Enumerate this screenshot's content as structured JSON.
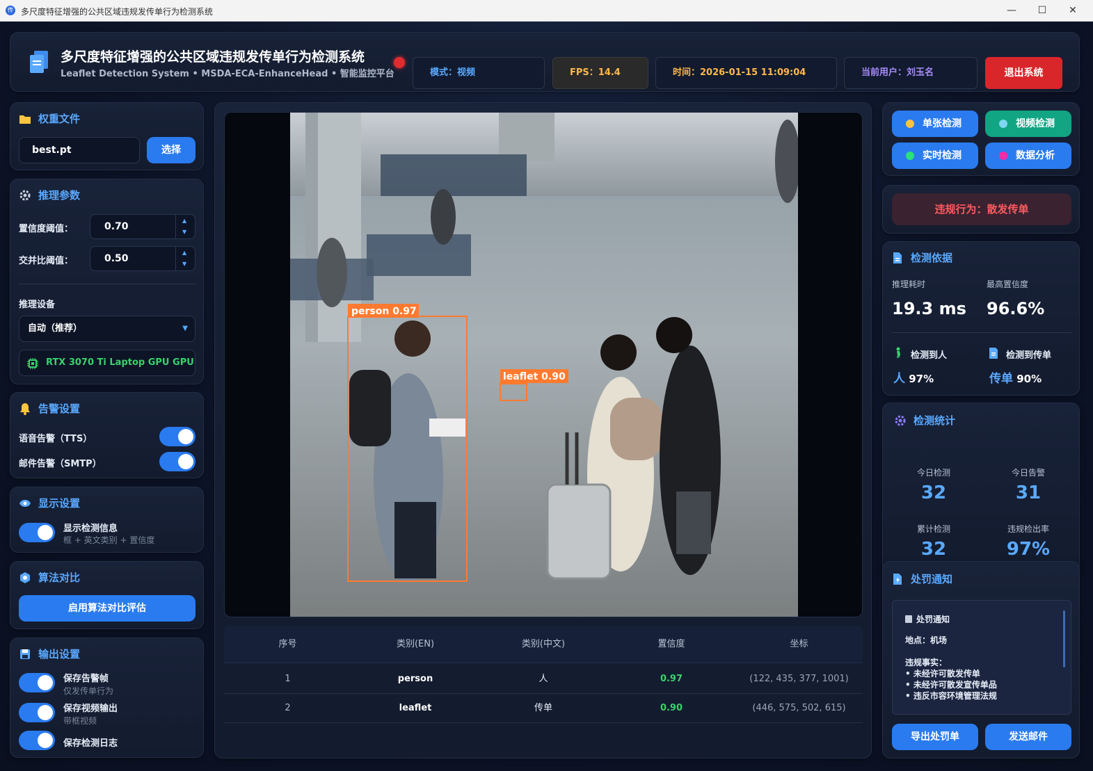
{
  "window": {
    "title": "多尺度特征增强的公共区域违规发传单行为检测系统",
    "app_icon": "传",
    "minimize": "—",
    "maximize": "☐",
    "close": "✕"
  },
  "header": {
    "title": "多尺度特征增强的公共区域违规发传单行为检测系统",
    "subtitle": "Leaflet Detection System • MSDA-ECA-EnhanceHead • 智能监控平台",
    "mode": "模式：视频",
    "fps": "FPS：14.4",
    "time": "时间：2026-01-15 11:09:04",
    "user": "当前用户：刘玉名",
    "logout": "退出系统"
  },
  "left": {
    "weights": {
      "title": "权重文件",
      "file": "best.pt",
      "select": "选择"
    },
    "infer": {
      "title": "推理参数",
      "conf_label": "置信度阈值：",
      "conf_value": "0.70",
      "iou_label": "交并比阈值：",
      "iou_value": "0.50",
      "device_label": "推理设备",
      "device_value": "自动（推荐）",
      "gpu": "RTX 3070 Ti Laptop GPU GPU"
    },
    "alarm": {
      "title": "告警设置",
      "tts": "语音告警（TTS）",
      "smtp": "邮件告警（SMTP）"
    },
    "display": {
      "title": "显示设置",
      "show": "显示检测信息",
      "show_sub": "框 + 英文类别 + 置信度"
    },
    "compare": {
      "title": "算法对比",
      "button": "启用算法对比评估"
    },
    "output": {
      "title": "输出设置",
      "save_frames": "保存告警帧",
      "save_frames_sub": "仅发传单行为",
      "save_video": "保存视频输出",
      "save_video_sub": "带框视频",
      "save_log": "保存检测日志"
    }
  },
  "center": {
    "detections": [
      {
        "label": "person 0.97"
      },
      {
        "label": "leaflet 0.90"
      }
    ],
    "table": {
      "headers": [
        "序号",
        "类别(EN)",
        "类别(中文)",
        "置信度",
        "坐标"
      ],
      "rows": [
        [
          "1",
          "person",
          "人",
          "0.97",
          "(122, 435, 377, 1001)"
        ],
        [
          "2",
          "leaflet",
          "传单",
          "0.90",
          "(446, 575, 502, 615)"
        ]
      ]
    }
  },
  "right": {
    "modes": {
      "single": "单张检测",
      "video": "视频检测",
      "realtime": "实时检测",
      "analysis": "数据分析"
    },
    "violation": "违规行为：散发传单",
    "basis": {
      "title": "检测依据",
      "infer_time_label": "推理耗时",
      "infer_time": "19.3 ms",
      "max_conf_label": "最高置信度",
      "max_conf": "96.6%",
      "person_label": "检测到人",
      "person_name": "人",
      "person_val": "97%",
      "leaflet_label": "检测到传单",
      "leaflet_name": "传单",
      "leaflet_val": "90%"
    },
    "stats": {
      "title": "检测统计",
      "today_label": "今日检测",
      "today": "32",
      "alarm_label": "今日告警",
      "alarm": "31",
      "total_label": "累计检测",
      "total": "32",
      "rate_label": "违规检出率",
      "rate": "97%"
    },
    "notice": {
      "title": "处罚通知",
      "inner_title": "处罚通知",
      "location": "地点：机场",
      "facts_title": "违规事实：",
      "facts": [
        "• 未经许可散发传单",
        "• 未经许可散发宣传单品",
        "• 违反市容环境管理法规"
      ],
      "export": "导出处罚单",
      "email": "发送邮件"
    }
  },
  "colors": {
    "accent": "#2a7bef",
    "danger": "#d9262b",
    "box": "#ff7a2f",
    "ok": "#38d26b"
  }
}
